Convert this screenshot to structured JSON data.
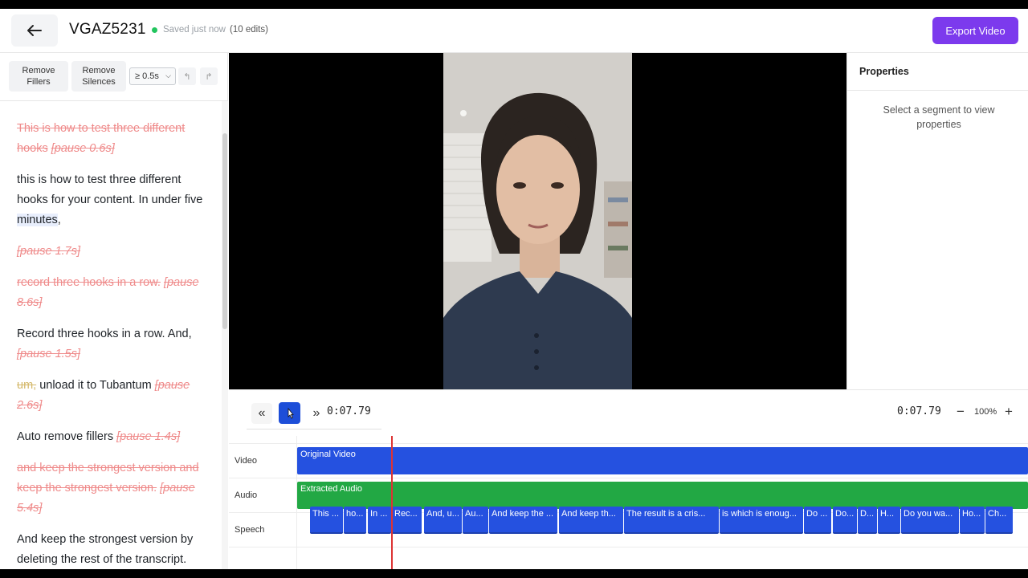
{
  "header": {
    "back_label": "←",
    "title": "VGAZ5231",
    "save_status": "Saved just now",
    "edit_count": "(10 edits)",
    "export_label": "Export Video",
    "accent_color": "#7c3aed"
  },
  "toolbar": {
    "remove_fillers_1": "Remove",
    "remove_fillers_2": "Fillers",
    "remove_silences_1": "Remove",
    "remove_silences_2": "Silences",
    "threshold_value": "≥ 0.5s",
    "undo_icon": "↰",
    "redo_icon": "↱"
  },
  "transcript": {
    "p1_deleted": "This is how to test three different hooks",
    "p1_pause": "[pause 0.6s]",
    "p2_text": "this is how to test three different hooks for your content. In under five",
    "p2_highlight": "minutes",
    "p2_end": ",",
    "p3_pause": "[pause 1.7s]",
    "p4_deleted": "record three hooks in a row.",
    "p4_pause": "[pause 8.6s]",
    "p5_text": "Record three hooks in a row. And,",
    "p5_pause": "[pause 1.5s]",
    "p6_filler": "um,",
    "p6_text": "unload it to Tubantum",
    "p6_pause": "[pause 2.6s]",
    "p7_text": "Auto remove fillers",
    "p7_pause": "[pause 1.4s]",
    "p8_deleted": "and keep the strongest version and keep the strongest version.",
    "p8_pause": "[pause 5.4s]",
    "p9_text": "And keep the strongest version by deleting the rest of the transcript."
  },
  "properties": {
    "title": "Properties",
    "hint": "Select a segment to view properties"
  },
  "controls": {
    "rewind_icon": "«",
    "forward_icon": "»",
    "current_time": "0:07.79",
    "total_time": "0:07.79",
    "zoom_out": "−",
    "zoom_level": "100%",
    "zoom_in": "+"
  },
  "timeline": {
    "track_video": "Video",
    "track_audio": "Audio",
    "track_speech": "Speech",
    "video_clip": "Original Video",
    "audio_clip": "Extracted Audio",
    "segments": [
      "This ...",
      "ho...",
      "In ...",
      "Rec...",
      "And, u...",
      "Au...",
      "And keep the ...",
      "And keep th...",
      "The result is a cris...",
      "is which is enoug...",
      "Do ...",
      "Do...",
      "D...",
      "H...",
      "Do you wa...",
      "Ho...",
      "Ch..."
    ],
    "video_color": "#2551e0",
    "audio_color": "#22a844",
    "playhead_color": "#dd3333"
  }
}
